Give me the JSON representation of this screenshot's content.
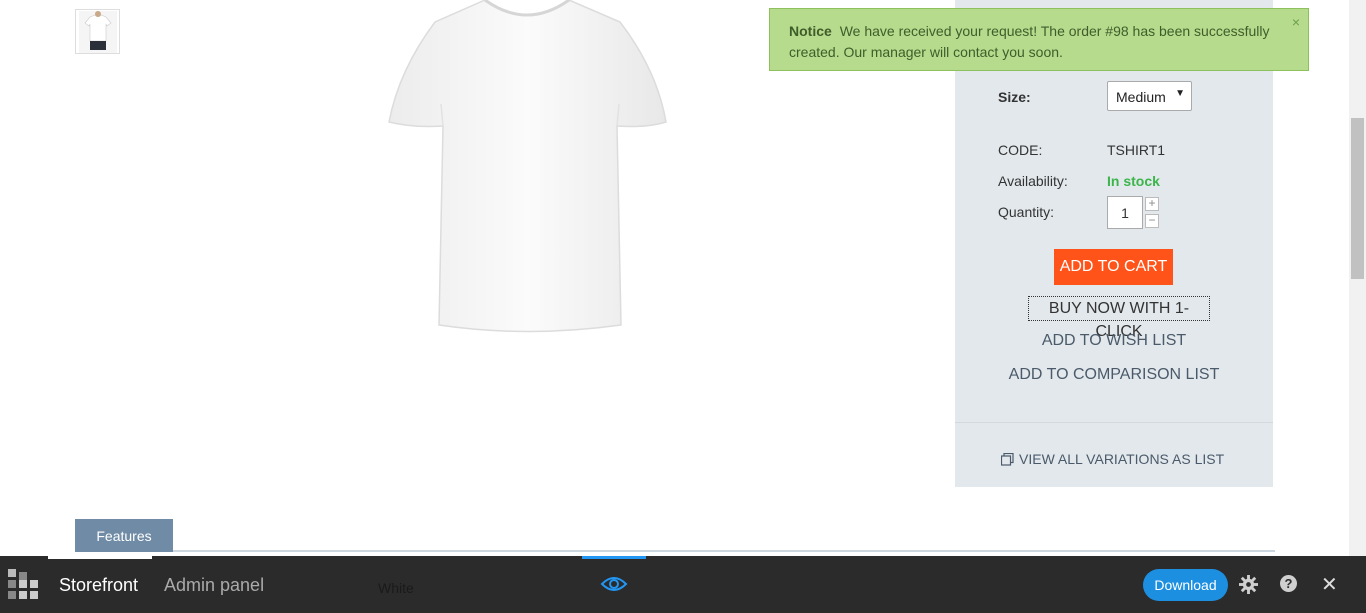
{
  "product": {
    "image_alt": "white t-shirt",
    "size_label": "Size:",
    "size_value": "Medium",
    "code_label": "CODE:",
    "code_value": "TSHIRT1",
    "availability_label": "Availability:",
    "availability_value": "In stock",
    "quantity_label": "Quantity:",
    "quantity_value": "1",
    "add_to_cart": "ADD TO CART",
    "buy_now": "BUY NOW WITH 1-CLICK",
    "add_wish": "ADD TO WISH LIST",
    "add_compare": "ADD TO COMPARISON LIST",
    "view_variations": "VIEW ALL VARIATIONS AS LIST"
  },
  "notice": {
    "title": "Notice",
    "message": "We have received your request! The order #98 has been successfully created. Our manager will contact you soon.",
    "close": "×"
  },
  "tabs": {
    "features": "Features"
  },
  "bottom_bar": {
    "storefront": "Storefront",
    "admin_panel": "Admin panel",
    "color_value": "White",
    "download": "Download",
    "help": "?",
    "close": "✕"
  },
  "colors": {
    "add_to_cart": "#ff5319",
    "in_stock": "#3cb54a",
    "notice_bg": "#b6db8d",
    "download": "#1d8fe1",
    "features_tab": "#6f8ba6"
  }
}
